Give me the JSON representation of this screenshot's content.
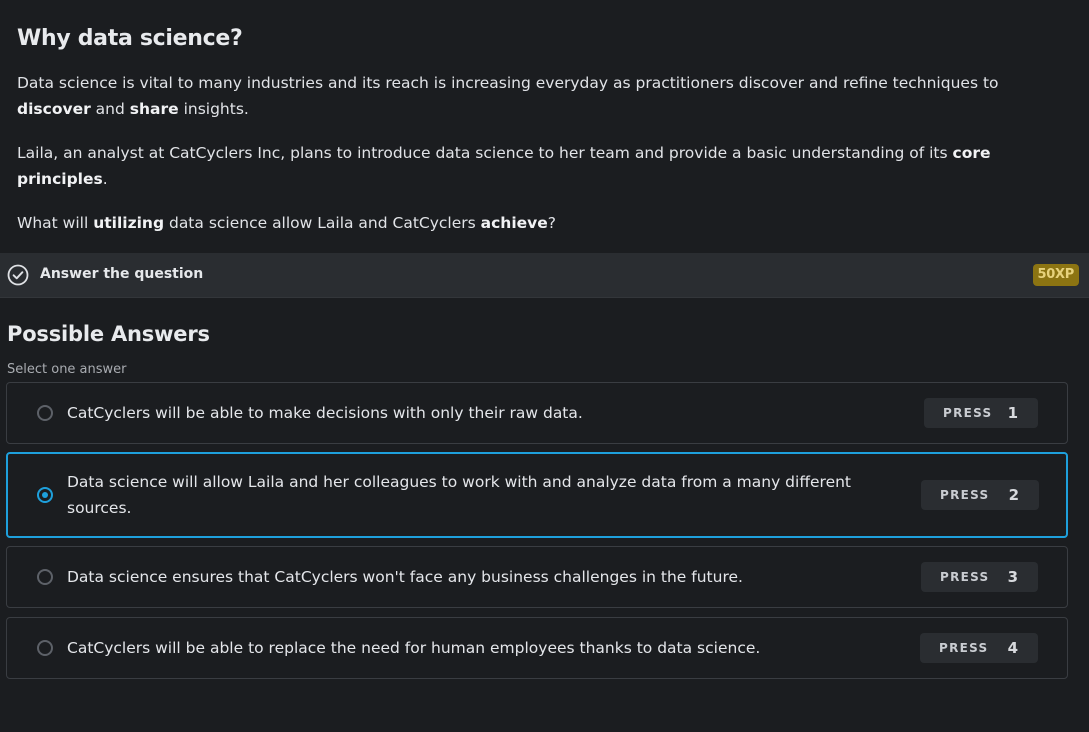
{
  "context": {
    "title": "Why data science?",
    "p1_a": "Data science is vital to many industries and its reach is increasing everyday as practitioners discover and refine techniques to ",
    "p1_b1": "discover",
    "p1_c": " and ",
    "p1_b2": "share",
    "p1_d": " insights.",
    "p2_a": "Laila, an analyst at CatCyclers Inc, plans to introduce data science to her team and provide a basic understanding of its ",
    "p2_b": "core principles",
    "p2_c": ".",
    "p3_a": "What will ",
    "p3_b1": "utilizing",
    "p3_c": " data science allow Laila and CatCyclers ",
    "p3_b2": "achieve",
    "p3_d": "?"
  },
  "task": {
    "icon": "check-circle-icon",
    "label": "Answer the question",
    "xp": "50XP",
    "xp_color": "#8c7412"
  },
  "answers": {
    "heading": "Possible Answers",
    "subheading": "Select one answer",
    "accent_color": "#1ea0dc",
    "selected_index": 2,
    "options": [
      {
        "text": "CatCyclers will be able to make decisions with only their raw data.",
        "press_label": "PRESS",
        "key": "1"
      },
      {
        "text": "Data science will allow Laila and her colleagues to work with and analyze data from a many different sources.",
        "press_label": "PRESS",
        "key": "2"
      },
      {
        "text": "Data science ensures that CatCyclers won't face any business challenges in the future.",
        "press_label": "PRESS",
        "key": "3"
      },
      {
        "text": "CatCyclers will be able to replace the need for human employees thanks to data science.",
        "press_label": "PRESS",
        "key": "4"
      }
    ]
  }
}
